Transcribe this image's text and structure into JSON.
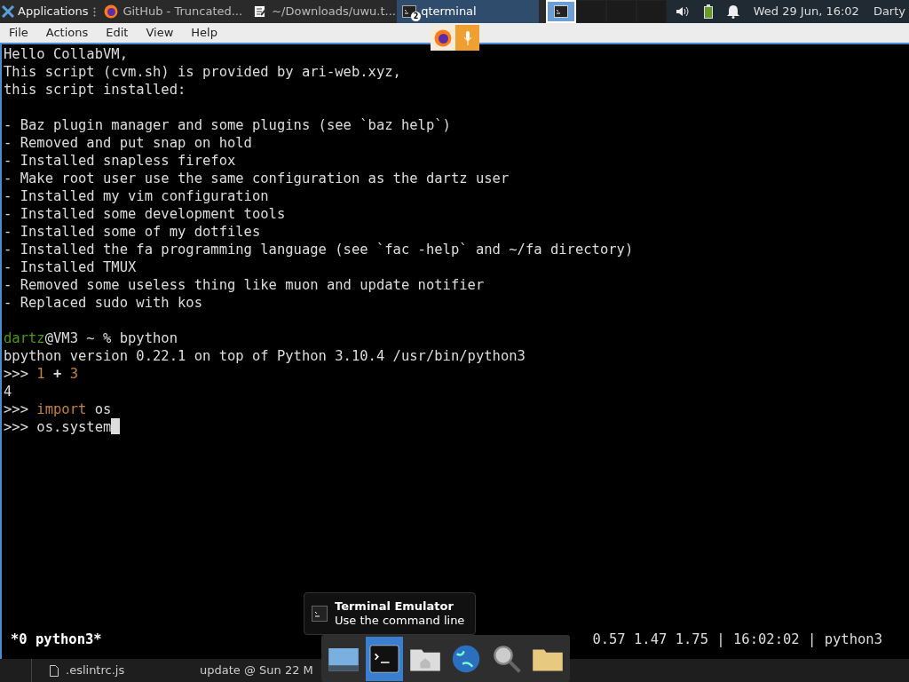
{
  "panel": {
    "apps_label": "Applications",
    "tasks": [
      {
        "label": "GitHub - Truncated...",
        "selected": false
      },
      {
        "label": "~/Downloads/uwu.t...",
        "selected": false
      },
      {
        "label": "qterminal",
        "badge": "2",
        "selected": true
      }
    ],
    "workspaces": [
      {
        "selected": true
      },
      {
        "selected": false
      },
      {
        "selected": false
      },
      {
        "selected": false
      }
    ],
    "clock": "Wed 29 Jun, 16:02",
    "user": "Darty"
  },
  "menu": [
    "File",
    "Actions",
    "Edit",
    "View",
    "Help"
  ],
  "terminal": {
    "lines": [
      {
        "segments": [
          {
            "text": "Hello CollabVM,"
          }
        ]
      },
      {
        "segments": [
          {
            "text": "This script (cvm.sh) is provided by ari-web.xyz,"
          }
        ]
      },
      {
        "segments": [
          {
            "text": "this script installed:"
          }
        ]
      },
      {
        "kind": "blank"
      },
      {
        "segments": [
          {
            "text": "- Baz plugin manager and some plugins (see `baz help`)"
          }
        ]
      },
      {
        "segments": [
          {
            "text": "- Removed and put snap on hold"
          }
        ]
      },
      {
        "segments": [
          {
            "text": "- Installed snapless firefox"
          }
        ]
      },
      {
        "segments": [
          {
            "text": "- Make root user use the same configuration as the dartz user"
          }
        ]
      },
      {
        "segments": [
          {
            "text": "- Installed my vim configuration"
          }
        ]
      },
      {
        "segments": [
          {
            "text": "- Installed some development tools"
          }
        ]
      },
      {
        "segments": [
          {
            "text": "- Installed some of my dotfiles"
          }
        ]
      },
      {
        "segments": [
          {
            "text": "- Installed the fa programming language (see `fac -help` and ~/fa directory)"
          }
        ]
      },
      {
        "segments": [
          {
            "text": "- Installed TMUX"
          }
        ]
      },
      {
        "segments": [
          {
            "text": "- Removed some useless thing like muon and update notifier"
          }
        ]
      },
      {
        "segments": [
          {
            "text": "- Replaced sudo with kos"
          }
        ]
      },
      {
        "kind": "blank"
      },
      {
        "segments": [
          {
            "text": "dartz",
            "color": "#4e9a06"
          },
          {
            "text": "@VM3 ~ % bpython"
          }
        ]
      },
      {
        "segments": [
          {
            "text": "bpython version 0.22.1 on top of Python 3.10.4 /usr/bin/python3"
          }
        ]
      },
      {
        "segments": [
          {
            "text": ">>> "
          },
          {
            "text": "1",
            "color": "#c4813a"
          },
          {
            "text": " + ",
            "bold": true
          },
          {
            "text": "3",
            "color": "#c4813a"
          }
        ]
      },
      {
        "segments": [
          {
            "text": "4"
          }
        ]
      },
      {
        "segments": [
          {
            "text": ">>> "
          },
          {
            "text": "import",
            "color": "#c4813a"
          },
          {
            "text": " os"
          }
        ]
      },
      {
        "segments": [
          {
            "text": ">>> os.system"
          }
        ],
        "cursor": true
      }
    ],
    "status_left": "*0 python3*",
    "status_right": "0.57 1.47 1.75 | 16:02:02 | python3"
  },
  "tooltip": {
    "title": "Terminal Emulator",
    "subtitle": "Use the command line"
  },
  "taskbar": [
    {
      "label": ".eslintrc.js"
    },
    {
      "label": "update @ Sun 22 M"
    }
  ]
}
